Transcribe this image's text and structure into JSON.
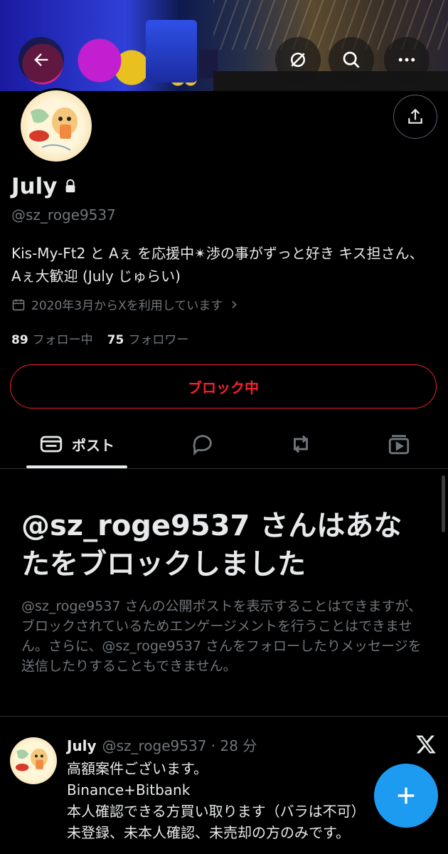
{
  "profile": {
    "name": "July",
    "handle": "@sz_roge9537",
    "bio": "Kis-My-Ft2 と Aぇ を応援中✴︎渉の事がずっと好き キス担さん、Aぇ大歓迎 (July じゅらい)",
    "joined": "2020年3月からXを利用しています",
    "following_count": "89",
    "following_label": "フォロー中",
    "followers_count": "75",
    "followers_label": "フォロワー",
    "block_button": "ブロック中"
  },
  "tabs": {
    "posts_label": "ポスト"
  },
  "blocked_notice": {
    "title": "@sz_roge9537 さんはあなたをブロックしました",
    "description": "@sz_roge9537 さんの公開ポストを表示することはできますが、ブロックされているためエンゲージメントを行うことはできません。さらに、@sz_roge9537 さんをフォローしたりメッセージを送信したりすることもできません。"
  },
  "tweet": {
    "name": "July",
    "meta": "@sz_roge9537 · 28 分",
    "lines": [
      "高額案件ございます。",
      "Binance+Bitbank",
      "本人確認できる方買い取ります（バラは不可）",
      "未登録、未本人確認、未売却の方のみです。"
    ]
  },
  "icons": {
    "back": "arrow-left-icon",
    "translate": "no-translate-icon",
    "search": "search-icon",
    "more": "more-icon",
    "share": "share-icon",
    "lock": "lock-icon",
    "calendar": "calendar-icon",
    "chevron": "chevron-right-icon",
    "compose": "plus-icon"
  },
  "colors": {
    "accent": "#1d9bf0",
    "danger": "#f4212e",
    "muted": "#71767b",
    "text": "#e7e9ea"
  }
}
